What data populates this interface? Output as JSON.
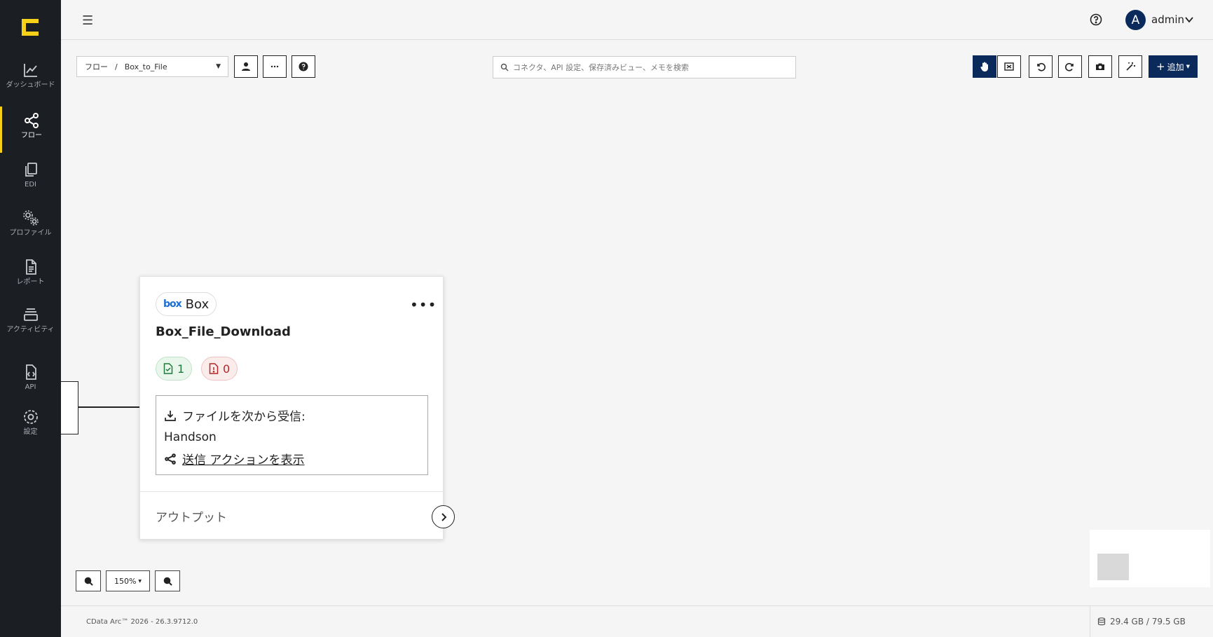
{
  "sidebar": {
    "items": [
      {
        "label": "ダッシュボード",
        "icon": "chart-line-icon"
      },
      {
        "label": "フロー",
        "icon": "share-nodes-icon"
      },
      {
        "label": "EDI",
        "icon": "copy-icon"
      },
      {
        "label": "プロファイル",
        "icon": "gears-icon"
      },
      {
        "label": "レポート",
        "icon": "file-text-icon"
      },
      {
        "label": "アクティビティ",
        "icon": "layers-icon"
      },
      {
        "label": "API",
        "icon": "file-code-icon"
      },
      {
        "label": "設定",
        "icon": "gear-icon"
      }
    ],
    "active_index": 1,
    "accent": "#f7d117"
  },
  "header": {
    "user_initial": "A",
    "user_name": "admin"
  },
  "toolbar": {
    "breadcrumb_root": "フロー",
    "breadcrumb_sep": "/",
    "breadcrumb_current": "Box_to_File",
    "search_placeholder": "コネクタ、API 設定、保存済みビュー、メモを検索",
    "add_label": "追加"
  },
  "card": {
    "connector_type": "Box",
    "connector_logo": "box",
    "title": "Box_File_Download",
    "success_count": "1",
    "error_count": "0",
    "receive_label": "ファイルを次から受信:",
    "receive_source": "Handson",
    "send_action_link": "送信 アクションを表示",
    "output_label": "アウトプット"
  },
  "zoom": {
    "level": "150%"
  },
  "footer": {
    "version": "CData Arc™ 2026 - 26.3.9712.0",
    "storage": "29.4 GB / 79.5 GB"
  },
  "colors": {
    "brand_navy": "#0a2a5c",
    "success": "#1d7a3b",
    "error": "#b52626"
  }
}
